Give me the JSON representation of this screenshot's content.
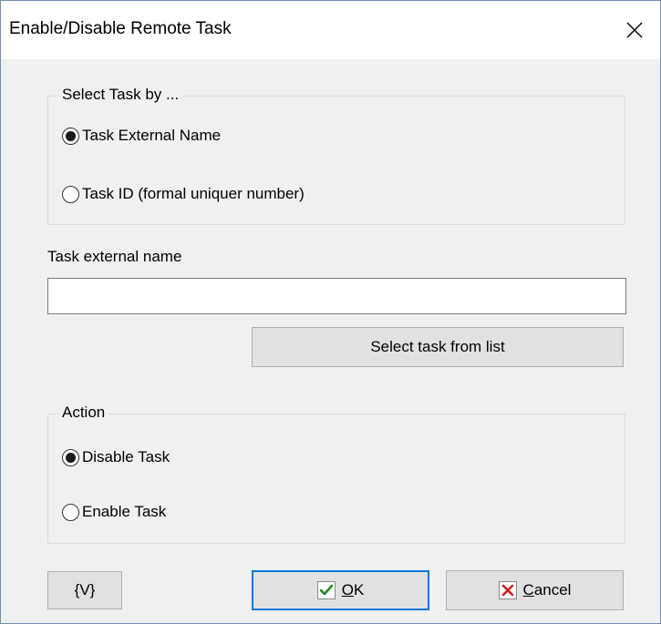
{
  "window": {
    "title": "Enable/Disable Remote Task",
    "close_glyph": "✕"
  },
  "select_group": {
    "legend": "Select Task by ...",
    "options": [
      {
        "label": "Task External Name",
        "selected": true
      },
      {
        "label": "Task ID (formal uniquer number)",
        "selected": false
      }
    ]
  },
  "task_name": {
    "label": "Task external name",
    "value": "",
    "placeholder": ""
  },
  "select_from_list_label": "Select task from list",
  "action_group": {
    "legend": "Action",
    "options": [
      {
        "label": "Disable Task",
        "selected": true
      },
      {
        "label": "Enable Task",
        "selected": false
      }
    ]
  },
  "footer": {
    "variables_label": "{V}",
    "ok_label": "OK",
    "cancel_label": "Cancel"
  },
  "colors": {
    "accent": "#0078d7",
    "ok_check": "#1f8a1f",
    "cancel_x": "#d21f1f"
  }
}
